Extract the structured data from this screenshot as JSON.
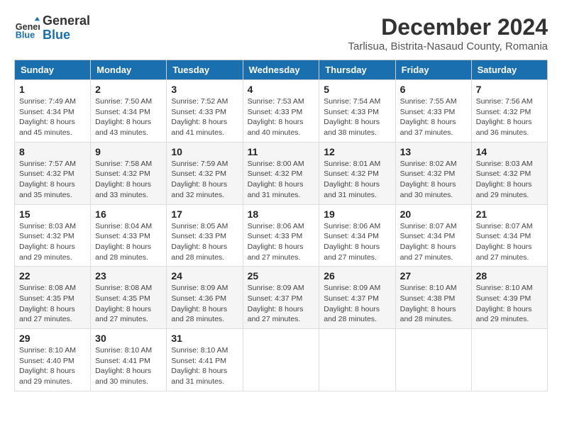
{
  "logo": {
    "text_general": "General",
    "text_blue": "Blue"
  },
  "title": "December 2024",
  "subtitle": "Tarlisua, Bistrita-Nasaud County, Romania",
  "days_of_week": [
    "Sunday",
    "Monday",
    "Tuesday",
    "Wednesday",
    "Thursday",
    "Friday",
    "Saturday"
  ],
  "weeks": [
    [
      {
        "day": "1",
        "sunrise": "7:49 AM",
        "sunset": "4:34 PM",
        "daylight": "8 hours and 45 minutes."
      },
      {
        "day": "2",
        "sunrise": "7:50 AM",
        "sunset": "4:34 PM",
        "daylight": "8 hours and 43 minutes."
      },
      {
        "day": "3",
        "sunrise": "7:52 AM",
        "sunset": "4:33 PM",
        "daylight": "8 hours and 41 minutes."
      },
      {
        "day": "4",
        "sunrise": "7:53 AM",
        "sunset": "4:33 PM",
        "daylight": "8 hours and 40 minutes."
      },
      {
        "day": "5",
        "sunrise": "7:54 AM",
        "sunset": "4:33 PM",
        "daylight": "8 hours and 38 minutes."
      },
      {
        "day": "6",
        "sunrise": "7:55 AM",
        "sunset": "4:33 PM",
        "daylight": "8 hours and 37 minutes."
      },
      {
        "day": "7",
        "sunrise": "7:56 AM",
        "sunset": "4:32 PM",
        "daylight": "8 hours and 36 minutes."
      }
    ],
    [
      {
        "day": "8",
        "sunrise": "7:57 AM",
        "sunset": "4:32 PM",
        "daylight": "8 hours and 35 minutes."
      },
      {
        "day": "9",
        "sunrise": "7:58 AM",
        "sunset": "4:32 PM",
        "daylight": "8 hours and 33 minutes."
      },
      {
        "day": "10",
        "sunrise": "7:59 AM",
        "sunset": "4:32 PM",
        "daylight": "8 hours and 32 minutes."
      },
      {
        "day": "11",
        "sunrise": "8:00 AM",
        "sunset": "4:32 PM",
        "daylight": "8 hours and 31 minutes."
      },
      {
        "day": "12",
        "sunrise": "8:01 AM",
        "sunset": "4:32 PM",
        "daylight": "8 hours and 31 minutes."
      },
      {
        "day": "13",
        "sunrise": "8:02 AM",
        "sunset": "4:32 PM",
        "daylight": "8 hours and 30 minutes."
      },
      {
        "day": "14",
        "sunrise": "8:03 AM",
        "sunset": "4:32 PM",
        "daylight": "8 hours and 29 minutes."
      }
    ],
    [
      {
        "day": "15",
        "sunrise": "8:03 AM",
        "sunset": "4:32 PM",
        "daylight": "8 hours and 29 minutes."
      },
      {
        "day": "16",
        "sunrise": "8:04 AM",
        "sunset": "4:33 PM",
        "daylight": "8 hours and 28 minutes."
      },
      {
        "day": "17",
        "sunrise": "8:05 AM",
        "sunset": "4:33 PM",
        "daylight": "8 hours and 28 minutes."
      },
      {
        "day": "18",
        "sunrise": "8:06 AM",
        "sunset": "4:33 PM",
        "daylight": "8 hours and 27 minutes."
      },
      {
        "day": "19",
        "sunrise": "8:06 AM",
        "sunset": "4:34 PM",
        "daylight": "8 hours and 27 minutes."
      },
      {
        "day": "20",
        "sunrise": "8:07 AM",
        "sunset": "4:34 PM",
        "daylight": "8 hours and 27 minutes."
      },
      {
        "day": "21",
        "sunrise": "8:07 AM",
        "sunset": "4:34 PM",
        "daylight": "8 hours and 27 minutes."
      }
    ],
    [
      {
        "day": "22",
        "sunrise": "8:08 AM",
        "sunset": "4:35 PM",
        "daylight": "8 hours and 27 minutes."
      },
      {
        "day": "23",
        "sunrise": "8:08 AM",
        "sunset": "4:35 PM",
        "daylight": "8 hours and 27 minutes."
      },
      {
        "day": "24",
        "sunrise": "8:09 AM",
        "sunset": "4:36 PM",
        "daylight": "8 hours and 28 minutes."
      },
      {
        "day": "25",
        "sunrise": "8:09 AM",
        "sunset": "4:37 PM",
        "daylight": "8 hours and 27 minutes."
      },
      {
        "day": "26",
        "sunrise": "8:09 AM",
        "sunset": "4:37 PM",
        "daylight": "8 hours and 28 minutes."
      },
      {
        "day": "27",
        "sunrise": "8:10 AM",
        "sunset": "4:38 PM",
        "daylight": "8 hours and 28 minutes."
      },
      {
        "day": "28",
        "sunrise": "8:10 AM",
        "sunset": "4:39 PM",
        "daylight": "8 hours and 29 minutes."
      }
    ],
    [
      {
        "day": "29",
        "sunrise": "8:10 AM",
        "sunset": "4:40 PM",
        "daylight": "8 hours and 29 minutes."
      },
      {
        "day": "30",
        "sunrise": "8:10 AM",
        "sunset": "4:41 PM",
        "daylight": "8 hours and 30 minutes."
      },
      {
        "day": "31",
        "sunrise": "8:10 AM",
        "sunset": "4:41 PM",
        "daylight": "8 hours and 31 minutes."
      },
      null,
      null,
      null,
      null
    ]
  ]
}
